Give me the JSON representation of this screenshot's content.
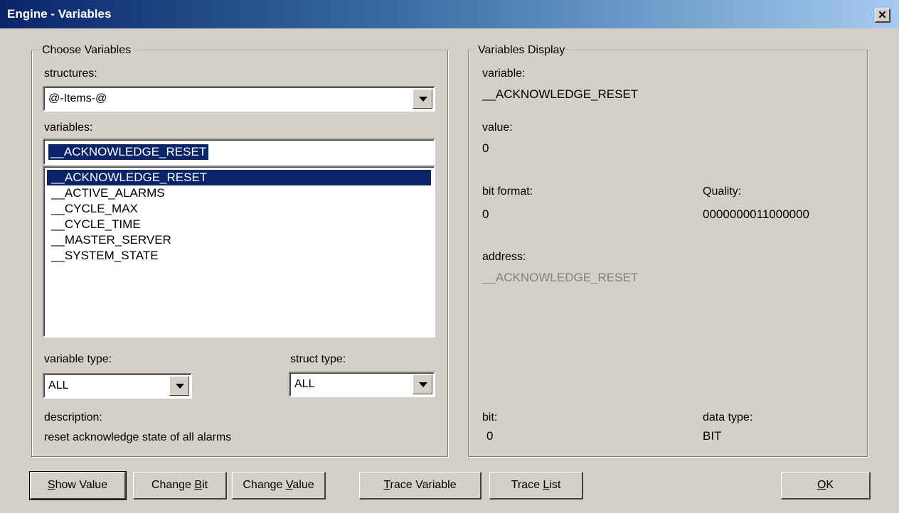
{
  "window": {
    "title": "Engine - Variables",
    "close_glyph": "✕"
  },
  "choose": {
    "legend": "Choose Variables",
    "structures_label": "structures:",
    "structures_value": "@-Items-@",
    "variables_label": "variables:",
    "variable_input": "__ACKNOWLEDGE_RESET",
    "variables_list": [
      "__ACKNOWLEDGE_RESET",
      "__ACTIVE_ALARMS",
      "__CYCLE_MAX",
      "__CYCLE_TIME",
      "__MASTER_SERVER",
      "__SYSTEM_STATE"
    ],
    "selected_index": 0,
    "variable_type_label": "variable type:",
    "variable_type_value": "ALL",
    "struct_type_label": "struct type:",
    "struct_type_value": "ALL",
    "description_label": "description:",
    "description_value": "reset acknowledge state of all alarms"
  },
  "display": {
    "legend": "Variables Display",
    "variable_label": "variable:",
    "variable_value": "__ACKNOWLEDGE_RESET",
    "value_label": "value:",
    "value_value": "0",
    "bit_format_label": "bit format:",
    "bit_format_value": "0",
    "quality_label": "Quality:",
    "quality_value": "0000000011000000",
    "address_label": "address:",
    "address_value": "__ACKNOWLEDGE_RESET",
    "bit_label": "bit:",
    "bit_value": "0",
    "data_type_label": "data type:",
    "data_type_value": "BIT"
  },
  "buttons": {
    "show_value": {
      "accel": "S",
      "rest": "how Value"
    },
    "change_bit": {
      "pre": "Change ",
      "accel": "B",
      "rest": "it"
    },
    "change_value": {
      "pre": "Change ",
      "accel": "V",
      "rest": "alue"
    },
    "trace_variable": {
      "accel": "T",
      "rest": "race Variable"
    },
    "trace_list": {
      "pre": "Trace ",
      "accel": "L",
      "rest": "ist"
    },
    "ok": {
      "accel": "O",
      "rest": "K"
    }
  }
}
